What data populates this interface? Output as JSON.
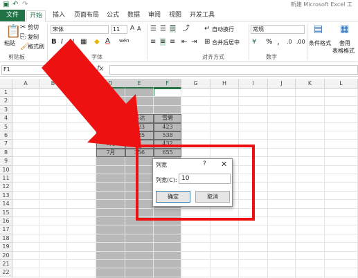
{
  "titlebar": {
    "save_icon": "save-icon",
    "undo_icon": "undo-icon",
    "redo_icon": "redo-icon",
    "title": "新建 Microsoft Excel 工"
  },
  "tabs": [
    "文件",
    "开始",
    "插入",
    "页面布局",
    "公式",
    "数据",
    "审阅",
    "视图",
    "开发工具"
  ],
  "ribbon": {
    "clipboard": {
      "paste": "粘贴",
      "cut": "剪切",
      "copy": "复制",
      "format_painter": "格式刷",
      "label": "剪贴板"
    },
    "font": {
      "name": "宋体",
      "size": "11",
      "bold": "B",
      "italic": "I",
      "underline": "U",
      "wen": "wén",
      "label": "字体"
    },
    "alignment": {
      "wrap": "自动换行",
      "merge": "合并后居中",
      "label": "对齐方式"
    },
    "number": {
      "format": "常规",
      "percent": "%",
      "comma": ",",
      "label": "数字"
    },
    "styles": {
      "conditional": "条件格式",
      "table": "套用",
      "table2": "表格格式"
    }
  },
  "formula_bar": {
    "name_box": "F1",
    "fx": "fx",
    "content": ""
  },
  "grid": {
    "columns": [
      "A",
      "B",
      "C",
      "D",
      "E",
      "F",
      "G",
      "H",
      "I",
      "J",
      "K",
      "L"
    ],
    "rows": [
      "1",
      "2",
      "3",
      "4",
      "5",
      "6",
      "7",
      "8",
      "9",
      "10",
      "11",
      "12",
      "13",
      "14",
      "15",
      "16",
      "17",
      "18",
      "19",
      "20",
      "21",
      "22"
    ],
    "selected_columns": [
      "D",
      "E",
      "F"
    ],
    "cells": {
      "E4": "苏达",
      "F4": "雪碧",
      "E5": "223",
      "F5": "423",
      "D6": "3月",
      "E6": "425",
      "F6": "538",
      "D7": "5月",
      "F7": "432",
      "D8": "7月",
      "E8": "356",
      "F8": "655"
    }
  },
  "dialog": {
    "title": "列宽",
    "help": "?",
    "close": "✕",
    "label": "列宽(C):",
    "value": "10",
    "ok": "确定",
    "cancel": "取消"
  },
  "annotation_color": "#ee1111"
}
